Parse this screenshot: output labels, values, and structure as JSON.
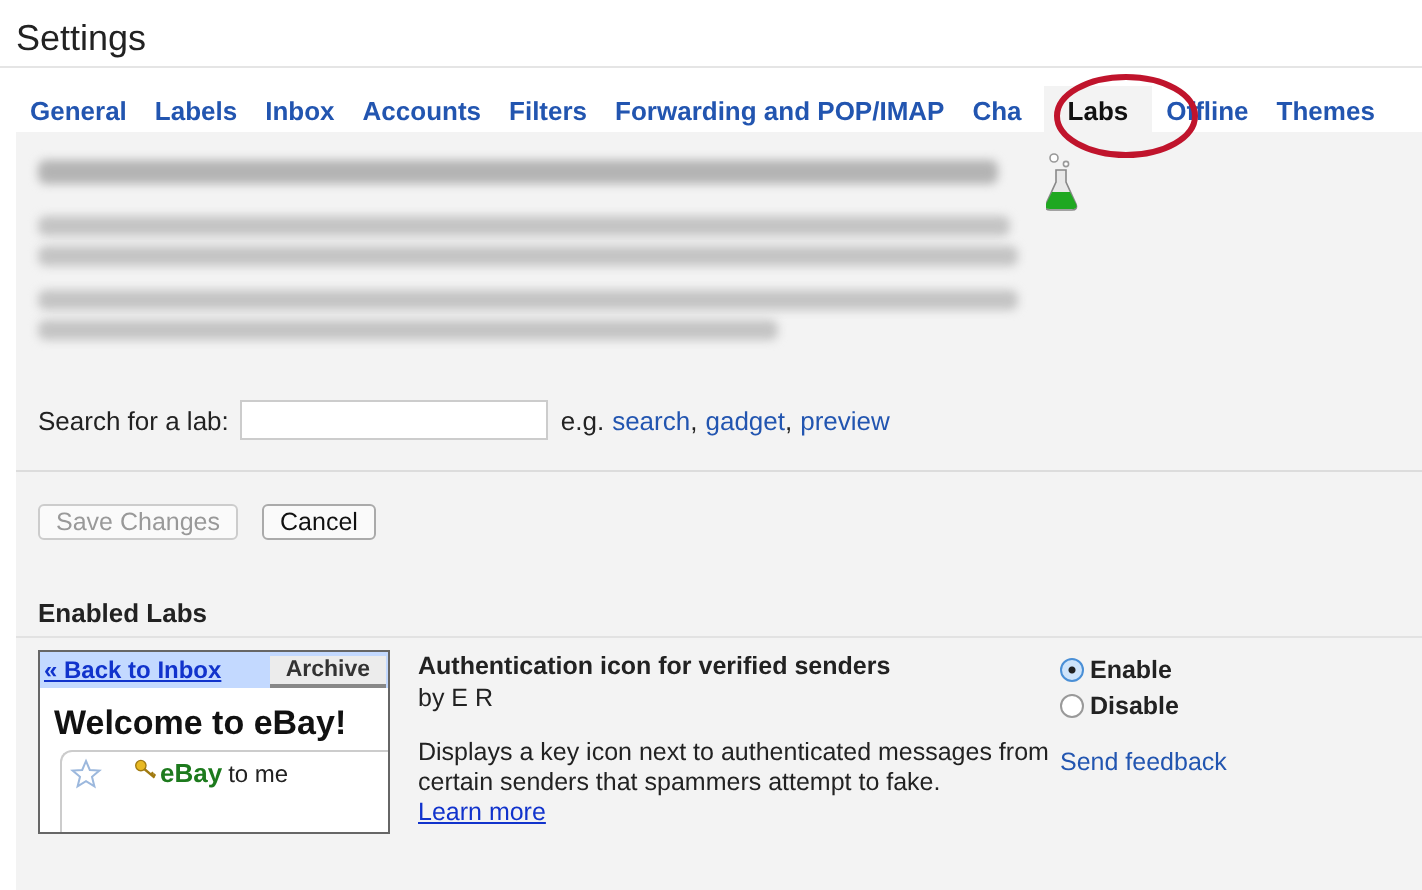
{
  "window": {
    "title": "Settings"
  },
  "tabs": [
    {
      "label": "General",
      "selected": false
    },
    {
      "label": "Labels",
      "selected": false
    },
    {
      "label": "Inbox",
      "selected": false
    },
    {
      "label": "Accounts",
      "selected": false
    },
    {
      "label": "Filters",
      "selected": false
    },
    {
      "label": "Forwarding and POP/IMAP",
      "selected": false
    },
    {
      "label": "Cha",
      "selected": false
    },
    {
      "label": "Labs",
      "selected": true
    },
    {
      "label": "Offline",
      "selected": false
    },
    {
      "label": "Themes",
      "selected": false
    }
  ],
  "search": {
    "label": "Search for a lab:",
    "examples_prefix": "e.g.",
    "separator": ",",
    "examples": [
      "search",
      "gadget",
      "preview"
    ]
  },
  "buttons": [
    {
      "label": "Save Changes",
      "disabled": true
    },
    {
      "label": "Cancel",
      "disabled": false
    }
  ],
  "enabled_labs": {
    "heading": "Enabled Labs",
    "labs": [
      {
        "preview": {
          "back_link": "« Back to Inbox",
          "archive_button": "Archive",
          "subject": "Welcome to eBay!",
          "sender": "eBay",
          "recipient": "to me"
        },
        "title": "Authentication icon for verified senders",
        "author": "by E R",
        "description": "Displays a key icon next to authenticated messages from certain senders that spammers attempt to fake.",
        "learn_more": "Learn more",
        "options": [
          {
            "label": "Enable",
            "selected": true
          },
          {
            "label": "Disable",
            "selected": false
          }
        ],
        "feedback": "Send feedback"
      }
    ]
  }
}
